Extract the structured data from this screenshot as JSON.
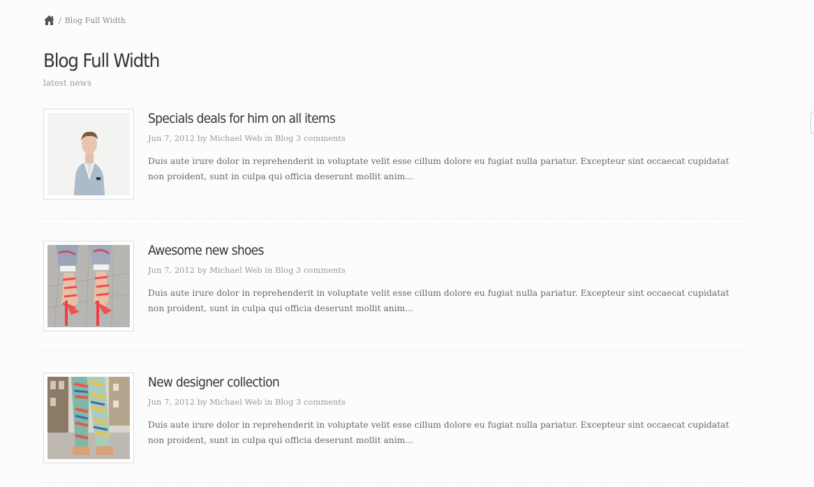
{
  "breadcrumb": {
    "separator": "/",
    "current": "Blog Full Width"
  },
  "page": {
    "title": "Blog Full Width",
    "subtitle": "latest news"
  },
  "posts": [
    {
      "title": "Specials deals for him on all items",
      "date": "Jun 7, 2012",
      "by": "by",
      "author": "Michael Web",
      "in": "in",
      "category": "Blog",
      "comments": "3 comments",
      "excerpt": "Duis aute irure dolor in reprehenderit in voluptate velit esse cillum dolore eu fugiat nulla pariatur. Excepteur sint occaecat cupidatat non proident, sunt in culpa qui officia deserunt mollit anim..."
    },
    {
      "title": "Awesome new shoes",
      "date": "Jun 7, 2012",
      "by": "by",
      "author": "Michael Web",
      "in": "in",
      "category": "Blog",
      "comments": "3 comments",
      "excerpt": "Duis aute irure dolor in reprehenderit in voluptate velit esse cillum dolore eu fugiat nulla pariatur. Excepteur sint occaecat cupidatat non proident, sunt in culpa qui officia deserunt mollit anim..."
    },
    {
      "title": "New designer collection",
      "date": "Jun 7, 2012",
      "by": "by",
      "author": "Michael Web",
      "in": "in",
      "category": "Blog",
      "comments": "3 comments",
      "excerpt": "Duis aute irure dolor in reprehenderit in voluptate velit esse cillum dolore eu fugiat nulla pariatur. Excepteur sint occaecat cupidatat non proident, sunt in culpa qui officia deserunt mollit anim..."
    }
  ],
  "icons": {
    "home": "home-icon"
  },
  "colors": {
    "title": "#333333",
    "meta": "#999999",
    "text": "#666666",
    "background": "#fcfcfc"
  }
}
